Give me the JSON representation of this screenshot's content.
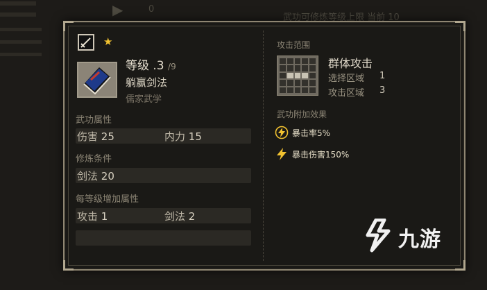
{
  "background": {
    "top_counter": "0",
    "top_notice": "武功可修炼等级上限 当前 10",
    "buttons": [
      "",
      "",
      ""
    ]
  },
  "colors": {
    "panel_border": "#8f8672",
    "star": "#f2c230",
    "bolt": "#f2c230",
    "book_cover": "#1e3a8a"
  },
  "skill": {
    "sword_icon": "sword-icon",
    "rarity_icon": "star-icon",
    "level_label": "等级",
    "level_value": ".3",
    "level_max": "/9",
    "name": "躺赢剑法",
    "school": "儒家武学"
  },
  "attributes": {
    "title": "武功属性",
    "items": [
      {
        "name": "伤害",
        "value": "25"
      },
      {
        "name": "内力",
        "value": "15"
      }
    ]
  },
  "requirements": {
    "title": "修炼条件",
    "items": [
      {
        "name": "剑法",
        "value": "20"
      }
    ]
  },
  "per_level": {
    "title": "每等级增加属性",
    "items": [
      {
        "name": "攻击",
        "value": "1"
      },
      {
        "name": "剑法",
        "value": "2"
      }
    ]
  },
  "attack_range": {
    "title": "攻击范围",
    "type": "群体攻击",
    "select_label": "选择区域",
    "select_value": "1",
    "attack_label": "攻击区域",
    "attack_value": "3",
    "grid_on": [
      [
        2,
        1
      ],
      [
        2,
        2
      ],
      [
        2,
        3
      ]
    ]
  },
  "effects": {
    "title": "武功附加效果",
    "items": [
      {
        "icon": "critical-rate-icon",
        "text": "暴击率5%"
      },
      {
        "icon": "critical-damage-icon",
        "text": "暴击伤害150%"
      }
    ]
  },
  "watermark": {
    "text": "九游",
    "logo": "9game-logo"
  }
}
